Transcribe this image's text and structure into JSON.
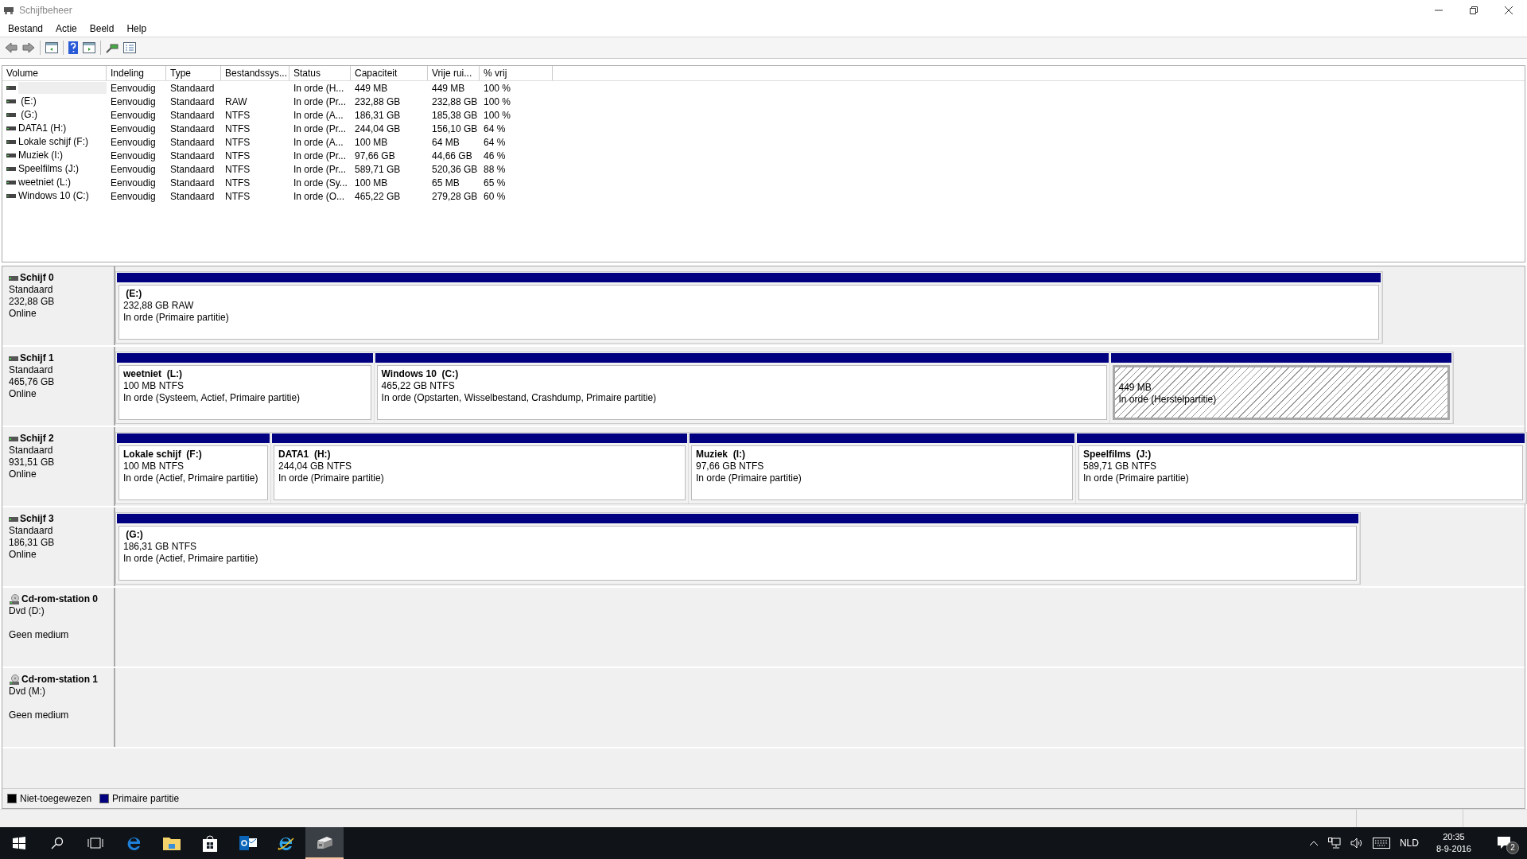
{
  "window": {
    "title": "Schijfbeheer"
  },
  "menu": [
    "Bestand",
    "Actie",
    "Beeld",
    "Help"
  ],
  "table": {
    "columns": [
      "Volume",
      "Indeling",
      "Type",
      "Bestandssys...",
      "Status",
      "Capaciteit",
      "Vrije rui...",
      "% vrij"
    ],
    "rows": [
      {
        "selected": true,
        "cells": [
          "",
          "Eenvoudig",
          "Standaard",
          "",
          "In orde (H...",
          "449 MB",
          "449 MB",
          "100 %"
        ]
      },
      {
        "selected": false,
        "cells": [
          " (E:)",
          "Eenvoudig",
          "Standaard",
          "RAW",
          "In orde (Pr...",
          "232,88 GB",
          "232,88 GB",
          "100 %"
        ]
      },
      {
        "selected": false,
        "cells": [
          " (G:)",
          "Eenvoudig",
          "Standaard",
          "NTFS",
          "In orde (A...",
          "186,31 GB",
          "185,38 GB",
          "100 %"
        ]
      },
      {
        "selected": false,
        "cells": [
          "DATA1 (H:)",
          "Eenvoudig",
          "Standaard",
          "NTFS",
          "In orde (Pr...",
          "244,04 GB",
          "156,10 GB",
          "64 %"
        ]
      },
      {
        "selected": false,
        "cells": [
          "Lokale schijf (F:)",
          "Eenvoudig",
          "Standaard",
          "NTFS",
          "In orde (A...",
          "100 MB",
          "64 MB",
          "64 %"
        ]
      },
      {
        "selected": false,
        "cells": [
          "Muziek (I:)",
          "Eenvoudig",
          "Standaard",
          "NTFS",
          "In orde (Pr...",
          "97,66 GB",
          "44,66 GB",
          "46 %"
        ]
      },
      {
        "selected": false,
        "cells": [
          "Speelfilms (J:)",
          "Eenvoudig",
          "Standaard",
          "NTFS",
          "In orde (Pr...",
          "589,71 GB",
          "520,36 GB",
          "88 %"
        ]
      },
      {
        "selected": false,
        "cells": [
          "weetniet (L:)",
          "Eenvoudig",
          "Standaard",
          "NTFS",
          "In orde (Sy...",
          "100 MB",
          "65 MB",
          "65 %"
        ]
      },
      {
        "selected": false,
        "cells": [
          "Windows 10 (C:)",
          "Eenvoudig",
          "Standaard",
          "NTFS",
          "In orde (O...",
          "465,22 GB",
          "279,28 GB",
          "60 %"
        ]
      }
    ]
  },
  "disks": [
    {
      "kind": "disk",
      "name": "Schijf 0",
      "lines": [
        "Standaard",
        "232,88 GB",
        "Online"
      ],
      "partitions": [
        {
          "kind": "primary",
          "selected": false,
          "name": " (E:)",
          "size": "232,88 GB RAW",
          "status": "In orde (Primaire partitie)"
        }
      ]
    },
    {
      "kind": "disk",
      "name": "Schijf 1",
      "lines": [
        "Standaard",
        "465,76 GB",
        "Online"
      ],
      "partitions": [
        {
          "kind": "primary",
          "selected": false,
          "name": "weetniet  (L:)",
          "size": "100 MB NTFS",
          "status": "In orde (Systeem, Actief, Primaire partitie)"
        },
        {
          "kind": "primary",
          "selected": false,
          "name": "Windows 10  (C:)",
          "size": "465,22 GB NTFS",
          "status": "In orde (Opstarten, Wisselbestand, Crashdump, Primaire partitie)"
        },
        {
          "kind": "recovery",
          "selected": true,
          "size": "449 MB",
          "status": "In orde (Herstelpartitie)"
        }
      ]
    },
    {
      "kind": "disk",
      "name": "Schijf 2",
      "lines": [
        "Standaard",
        "931,51 GB",
        "Online"
      ],
      "partitions": [
        {
          "kind": "primary",
          "selected": false,
          "name": "Lokale schijf  (F:)",
          "size": "100 MB NTFS",
          "status": "In orde (Actief, Primaire partitie)"
        },
        {
          "kind": "primary",
          "selected": false,
          "name": "DATA1  (H:)",
          "size": "244,04 GB NTFS",
          "status": "In orde (Primaire partitie)"
        },
        {
          "kind": "primary",
          "selected": false,
          "name": "Muziek  (I:)",
          "size": "97,66 GB NTFS",
          "status": "In orde (Primaire partitie)"
        },
        {
          "kind": "primary",
          "selected": false,
          "name": "Speelfilms  (J:)",
          "size": "589,71 GB NTFS",
          "status": "In orde (Primaire partitie)"
        }
      ]
    },
    {
      "kind": "disk",
      "name": "Schijf 3",
      "lines": [
        "Standaard",
        "186,31 GB",
        "Online"
      ],
      "partitions": [
        {
          "kind": "primary",
          "selected": false,
          "name": " (G:)",
          "size": "186,31 GB NTFS",
          "status": "In orde (Actief, Primaire partitie)"
        }
      ]
    },
    {
      "kind": "cdrom",
      "name": "Cd-rom-station 0",
      "lines": [
        "Dvd (D:)"
      ],
      "media": "Geen medium"
    },
    {
      "kind": "cdrom",
      "name": "Cd-rom-station 1",
      "lines": [
        "Dvd (M:)"
      ],
      "media": "Geen medium"
    }
  ],
  "legend": [
    {
      "label": "Niet-toegewezen",
      "color": "#000000"
    },
    {
      "label": "Primaire partitie",
      "color": "#000080"
    }
  ],
  "tray": {
    "language": "NLD",
    "time": "20:35",
    "date": "8-9-2016",
    "notifications": "2"
  }
}
